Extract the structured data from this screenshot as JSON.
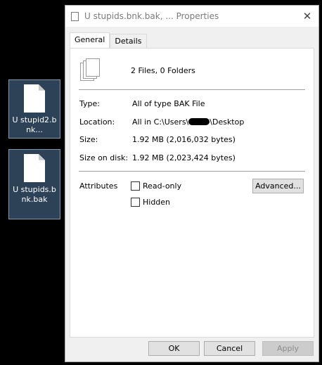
{
  "desktop": {
    "files": [
      {
        "label": "U stupid2.bnk..."
      },
      {
        "label": "U stupids.bnk.bak"
      }
    ]
  },
  "dialog": {
    "title": "U stupids.bnk.bak, ... Properties",
    "close_glyph": "✕",
    "tabs": [
      {
        "label": "General",
        "active": true
      },
      {
        "label": "Details",
        "active": false
      }
    ],
    "summary": "2 Files, 0 Folders",
    "rows": {
      "type": {
        "key": "Type:",
        "value": "All of type BAK File"
      },
      "location": {
        "key": "Location:",
        "value_prefix": "All in C:\\Users\\",
        "value_suffix": "\\Desktop"
      },
      "size": {
        "key": "Size:",
        "value": "1.92 MB (2,016,032 bytes)"
      },
      "size_on_disk": {
        "key": "Size on disk:",
        "value": "1.92 MB (2,023,424 bytes)"
      }
    },
    "attributes": {
      "label": "Attributes",
      "read_only": {
        "label": "Read-only",
        "checked": false
      },
      "hidden": {
        "label": "Hidden",
        "checked": false
      },
      "advanced_label": "Advanced..."
    },
    "buttons": {
      "ok": "OK",
      "cancel": "Cancel",
      "apply": "Apply"
    }
  }
}
